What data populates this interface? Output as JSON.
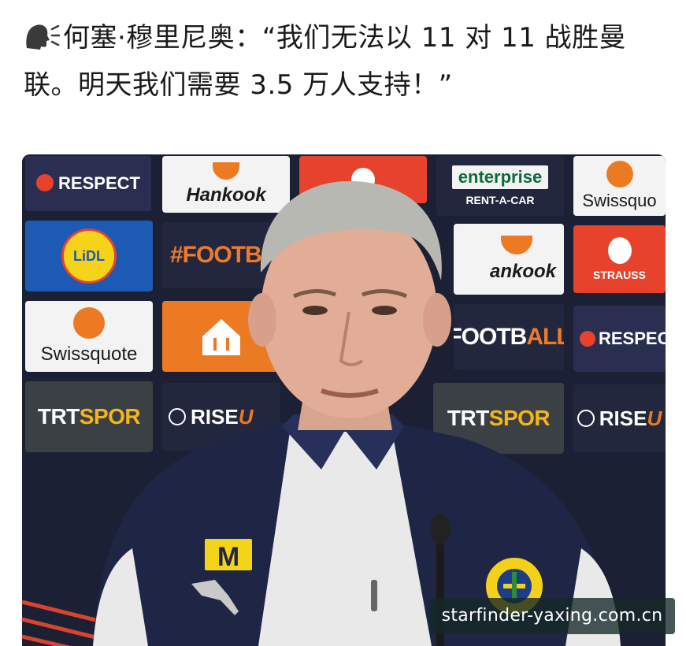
{
  "post": {
    "icon": "speaking-head-icon",
    "text": "何塞·穆里尼奥：“我们无法以 11 对 11 战胜曼联。明天我们需要 3.5 万人支持！”"
  },
  "backdrop": {
    "sponsors": {
      "respect": "RESPECT",
      "respect_partial": "RESPEC",
      "hankook": "Hankook",
      "hankook_partial": "ankook",
      "enterprise": "enterprise",
      "rent_a_car": "RENT-A-CAR",
      "swissquote": "Swissquote",
      "swissquote_partial": "Swissquo",
      "lidl": "LiDL",
      "football_hash": "#FOOTB",
      "football_a": "A",
      "football_all_prefix": "FOOTB",
      "football_all": "ALL",
      "strauss": "STRAUSS",
      "trt": "TRT",
      "spor": "SPOR",
      "rise": "RISE",
      "rise_u": "U"
    },
    "colors": {
      "orange": "#ec7a23",
      "blue": "#1d5ab3",
      "red": "#e6422c",
      "navy": "#1c2035"
    }
  },
  "jersey_brand": "M",
  "watermark": "starfinder-yaxing.com.cn"
}
